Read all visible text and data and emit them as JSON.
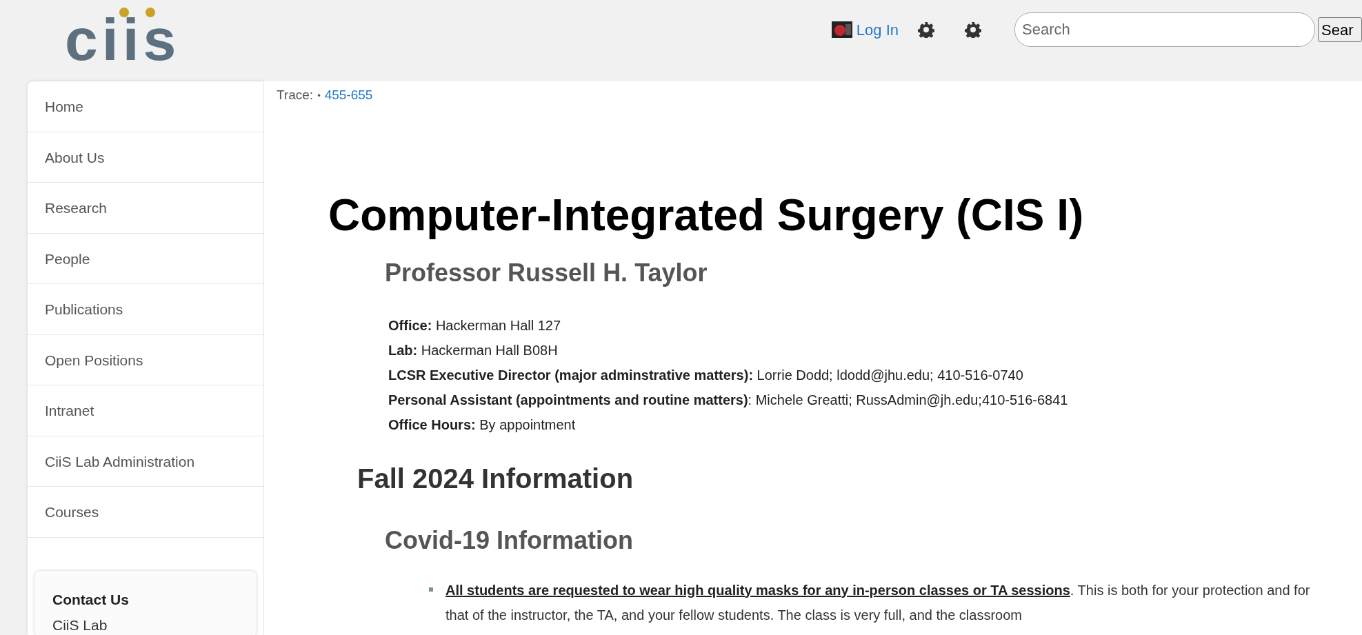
{
  "header": {
    "logo": "ciis",
    "login": "Log In",
    "search": {
      "placeholder": "Search"
    },
    "search_button": "Sear"
  },
  "sidebar": {
    "items": [
      {
        "label": "Home"
      },
      {
        "label": "About Us"
      },
      {
        "label": "Research"
      },
      {
        "label": "People"
      },
      {
        "label": "Publications"
      },
      {
        "label": "Open Positions"
      },
      {
        "label": "Intranet"
      },
      {
        "label": "CiiS Lab Administration"
      },
      {
        "label": "Courses"
      }
    ],
    "contact": {
      "title": "Contact Us",
      "line": "CiiS Lab"
    }
  },
  "content": {
    "trace_label": "Trace:",
    "trace_sep": "•",
    "trace_link": "455-655",
    "title": "Computer-Integrated Surgery (CIS I)",
    "professor": "Professor Russell H. Taylor",
    "info": [
      "**Office:** Hackerman Hall 127",
      "**Lab:** Hackerman Hall B08H",
      "**LCSR Executive Director (major adminstrative matters):** Lorrie Dodd; ldodd@jhu.edu; 410-516-0740",
      "**Personal Assistant (appointments and routine matters)**: Michele Greatti; RussAdmin@jh.edu;410-516-6841",
      "**Office Hours:** By appointment"
    ],
    "section": "Fall 2024 Information",
    "subsection": "Covid-19 Information",
    "bullets": [
      {
        "link": "All students are requested to wear high quality masks for any in-person classes or TA sessions",
        "text": ". This is both for your protection and for that of the instructor, the TA, and your fellow students. The class is very full, and the classroom"
      }
    ]
  }
}
